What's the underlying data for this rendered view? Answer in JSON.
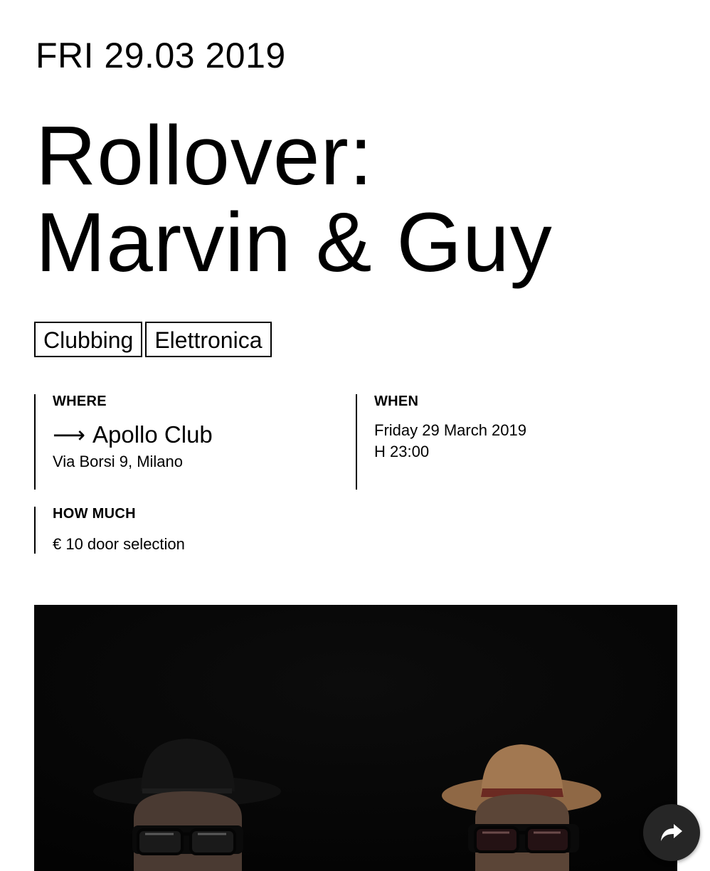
{
  "event": {
    "date_line": "FRI 29.03 2019",
    "title": "Rollover:\nMarvin & Guy",
    "tags": [
      "Clubbing",
      "Elettronica"
    ]
  },
  "where": {
    "label": "WHERE",
    "arrow": "⟶",
    "venue": "Apollo Club",
    "address": "Via Borsi 9, Milano"
  },
  "when": {
    "label": "WHEN",
    "date": "Friday 29 March 2019",
    "time": "H 23:00"
  },
  "how_much": {
    "label": "HOW MUCH",
    "price": "€ 10 door selection"
  },
  "photo": {
    "subject": "two-men-in-hats-and-sunglasses"
  },
  "share": {
    "icon": "share-arrow-icon"
  },
  "colors": {
    "text": "#000000",
    "background": "#ffffff",
    "share_button": "#262626",
    "photo_background": "#070707",
    "hat_brown": "#a27851",
    "hat_band": "#6b2a22",
    "hat_black": "#141414"
  }
}
